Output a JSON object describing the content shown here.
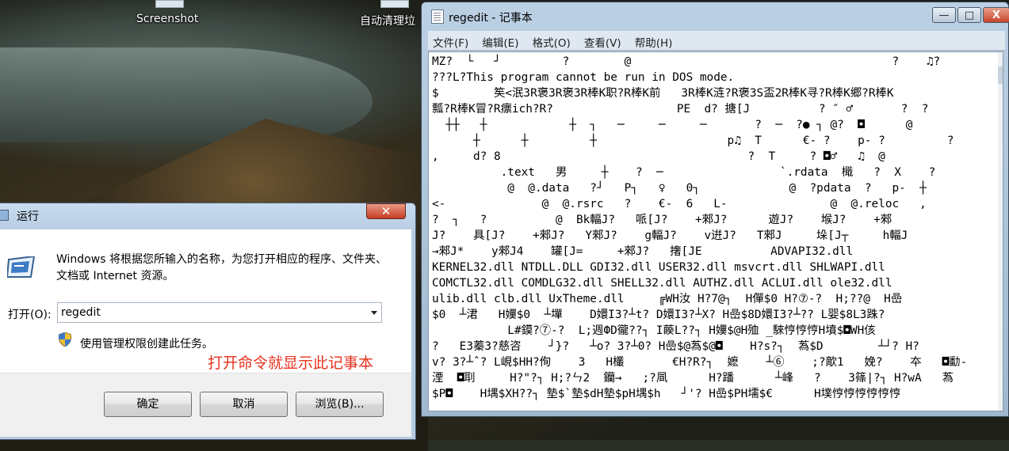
{
  "desktop": {
    "icons": [
      {
        "label": "Screenshot"
      },
      {
        "label": "自动清理垃"
      }
    ]
  },
  "notepad": {
    "title": "regedit - 记事本",
    "controls": {
      "minimize": "—",
      "maximize": "□",
      "close": "X"
    },
    "menu": [
      "文件(F)",
      "编辑(E)",
      "格式(O)",
      "查看(V)",
      "帮助(H)"
    ],
    "content": "MZ?  └   ┘         ?        @                                      ?    ♫?\n???L?This program cannot be run in DOS mode.\n$        笶<泯3R褒3R褒3R棒K职?R棒K前   3R棒K涟?R褒3S盃2R棒K寻?R棒K郷?R棒K\n瓢?R棒K冒?R瘭ich?R?                  PE  d? 搪[J          ? ″ ♂       ?  ?\n  ┼┼   ┼            ┼  ┐   ─     ─     ─       ?  ─  ?● ┐ @?  ◘      @\n      ┼      ┼         ┼                   p♫  T      €- ?    p- ?         ?\n,     d? 8                                    ?  T     ? ◘♂   ♫  @\n          .text   男     ┼    ?  ─                 `.rdata  檝   ?  X    ?\n           @  @.data   ?┘   P┐   ♀   0┐             @  ?pdata  ?   p-  ┼\n<-              @  @.rsrc   ?    €-  6   L-               @  @.reloc   ,\n?  ┐   ?          @  Bk輻J?   哌[J?    +郲J?      遊J?    堠J?    +郲\nJ?    具[J?    +郲J?   Y郲J?    g輻J?    v逬J?   T郲J     垛[J┬     h輻J\n→郲J*    y郲J4    罐[J=     +郲J?   撦[JE          ADVAPI32.dll\nKERNEL32.dll NTDLL.DLL GDI32.dll USER32.dll msvcrt.dll SHLWAPI.dll\nCOMCTL32.dll COMDLG32.dll SHELL32.dll AUTHZ.dll ACLUI.dll ole32.dll\nulib.dll clb.dll UxTheme.dll     ╔WH汝 H?7@┐  H僤$0 H?⑦-?  H;??@  H嵒\n$0  ┴涒   H嬽$0  ┴墠    D嬛I3?┴t? D嬛I3?┴X? H嵒$8D嬛I3?┴?? L婴$8L3跦?\n           L#鏌?⑦-?  L;週ФD徿??┐ I藈L??┐ H嬽$@H殈 _騋悙悙悙H墳$◘WH侅\n?   E3蓁3?慈咨    ┘}?   ┴o? 3?┴0? H嵒$@蒍$@◘    H?s?┐  蒍$D        ┴┘? H?\nv? 3?┴ˆ? L峴$HH?侚    3   H欉       €H?R?┐  嬷    ┴⑥    ;?歒1   娩?    夲   ◘勫-\n湮  ◘刵     H?\"?┐ H;?ㄣ2  钄→   ;?凬      H?蹯      ┴峰   ?    3篠|?┐ H?wA   蒍\n$P◘    H堣$XH??┐ 墊$`墊$dH墊$pH堣$h   ┘'? H嵒$PH壖$€      H墣悙悙悙悙悙悙"
  },
  "run_dialog": {
    "title": "运行",
    "close_glyph": "✕",
    "description": "Windows 将根据您所输入的名称，为您打开相应的程序、文件夹、文档或 Internet 资源。",
    "open_label": "打开(O):",
    "open_value": "regedit",
    "admin_text": "使用管理权限创建此任务。",
    "annotation": "打开命令就显示此记事本",
    "buttons": {
      "ok": "确定",
      "cancel": "取消",
      "browse": "浏览(B)..."
    }
  }
}
